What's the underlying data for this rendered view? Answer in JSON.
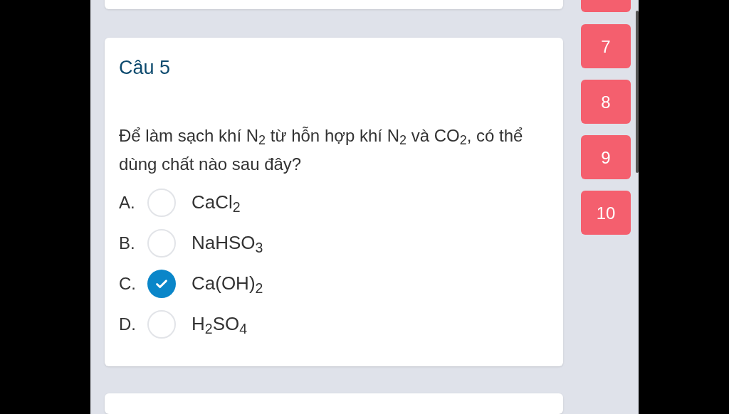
{
  "question_title": "Câu 5",
  "question_text": "Để làm sạch khí N$_{2}$ từ hỗn hợp khí N$_{2}$ và CO$_{2}$, có thể dùng chất nào sau đây?",
  "options": [
    {
      "letter": "A.",
      "text": "CaCl$_{2}$",
      "selected": false
    },
    {
      "letter": "B.",
      "text": "NaHSO$_{3}$",
      "selected": false
    },
    {
      "letter": "C.",
      "text": "Ca(OH)$_{2}$",
      "selected": true
    },
    {
      "letter": "D.",
      "text": "H$_{2}$SO$_{4}$",
      "selected": false
    }
  ],
  "question_nav": [
    {
      "label": "7"
    },
    {
      "label": "8"
    },
    {
      "label": "9"
    },
    {
      "label": "10"
    }
  ]
}
